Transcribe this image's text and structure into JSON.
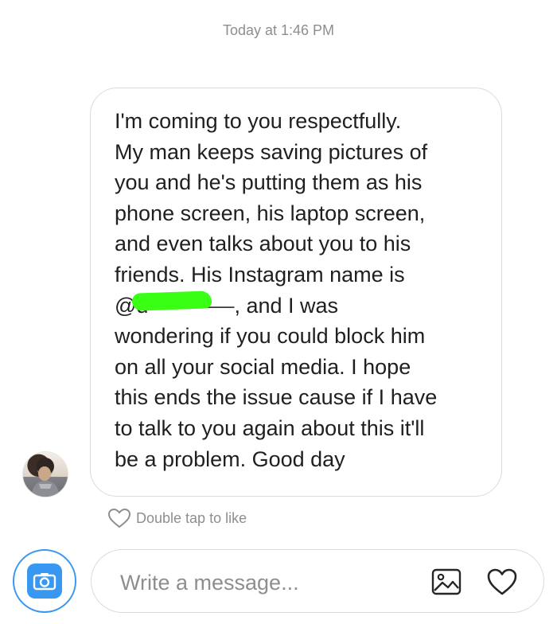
{
  "thread": {
    "timestamp": "Today at 1:46 PM"
  },
  "message": {
    "lines": [
      "I'm coming to you respectfully.",
      "My man keeps saving pictures of",
      "you and he's putting them as his",
      "phone screen, his laptop screen,",
      "and even talks about you to his",
      "friends. His Instagram name is",
      "",
      "wondering if you could block him",
      "on all your social media. I hope",
      "this ends the issue cause if I have",
      "to talk to you again about this it'll",
      "be a problem. Good day"
    ],
    "line7_prefix": "@d",
    "line7_redacted": "————",
    "line7_suffix": ", and I was"
  },
  "like": {
    "label": "Double tap to like",
    "icon": "heart-outline-icon"
  },
  "composer": {
    "placeholder": "Write a message...",
    "camera_icon": "camera-icon",
    "gallery_icon": "image-icon",
    "heart_icon": "heart-icon"
  },
  "colors": {
    "accent": "#3897f0",
    "border": "#dbdbdb",
    "muted_text": "#8e8e8e",
    "highlight": "#39ff14"
  }
}
